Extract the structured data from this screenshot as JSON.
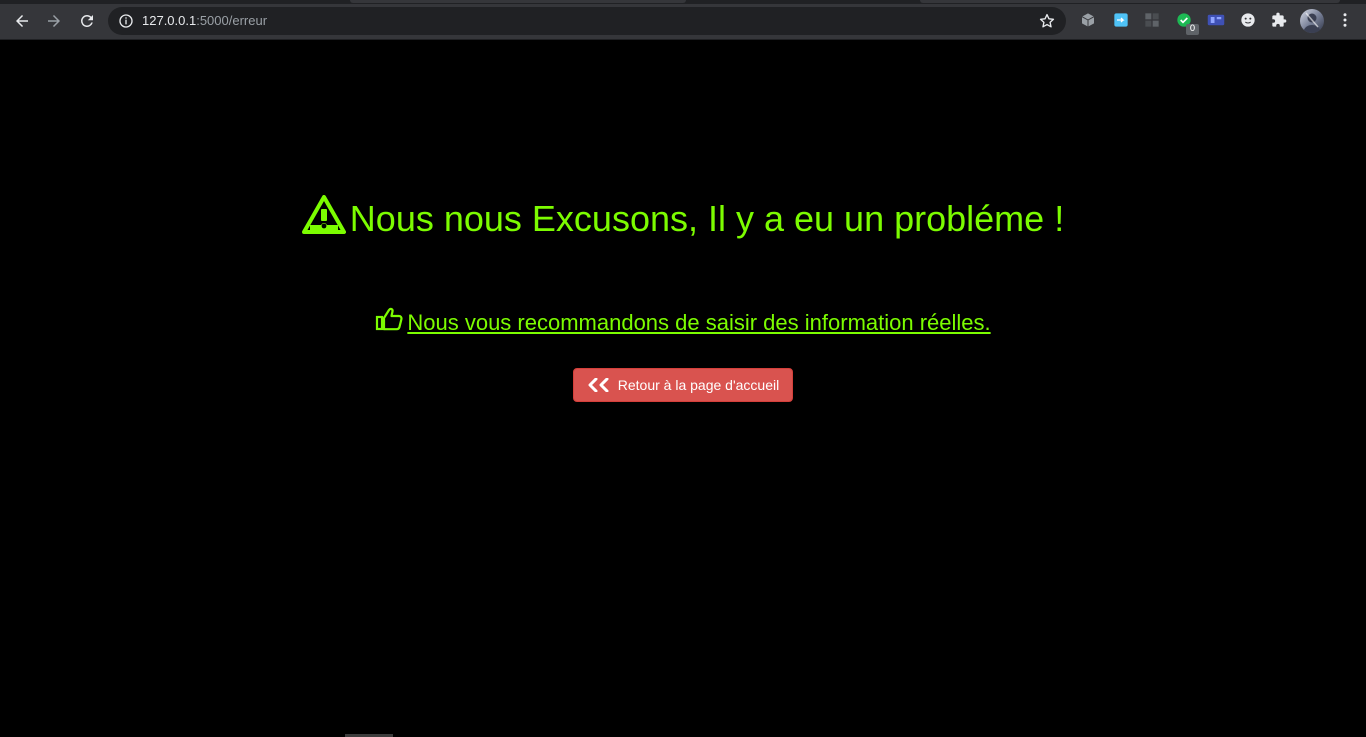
{
  "browser": {
    "url_host": "127.0.0.1",
    "url_path": ":5000/erreur",
    "extension_badge": "0"
  },
  "icons": {
    "back": "back-arrow-icon",
    "forward": "forward-arrow-icon",
    "reload": "reload-icon",
    "site_info": "info-icon",
    "bookmark": "star-icon",
    "extensions": "puzzle-icon",
    "menu": "kebab-menu-icon",
    "warning": "warning-triangle-icon",
    "thumbs_up": "thumbs-up-icon",
    "double_chevron": "double-chevron-left-icon"
  },
  "colors": {
    "page_background": "#000000",
    "accent_green": "#7cfc00",
    "button_danger": "#d9534f",
    "toolbar": "#35363a",
    "omnibox": "#202124"
  },
  "content": {
    "heading": "Nous nous Excusons, Il y a eu un probléme !",
    "recommendation": "Nous vous recommandons de saisir des information réelles.",
    "home_button_label": "Retour à la page d'accueil"
  }
}
